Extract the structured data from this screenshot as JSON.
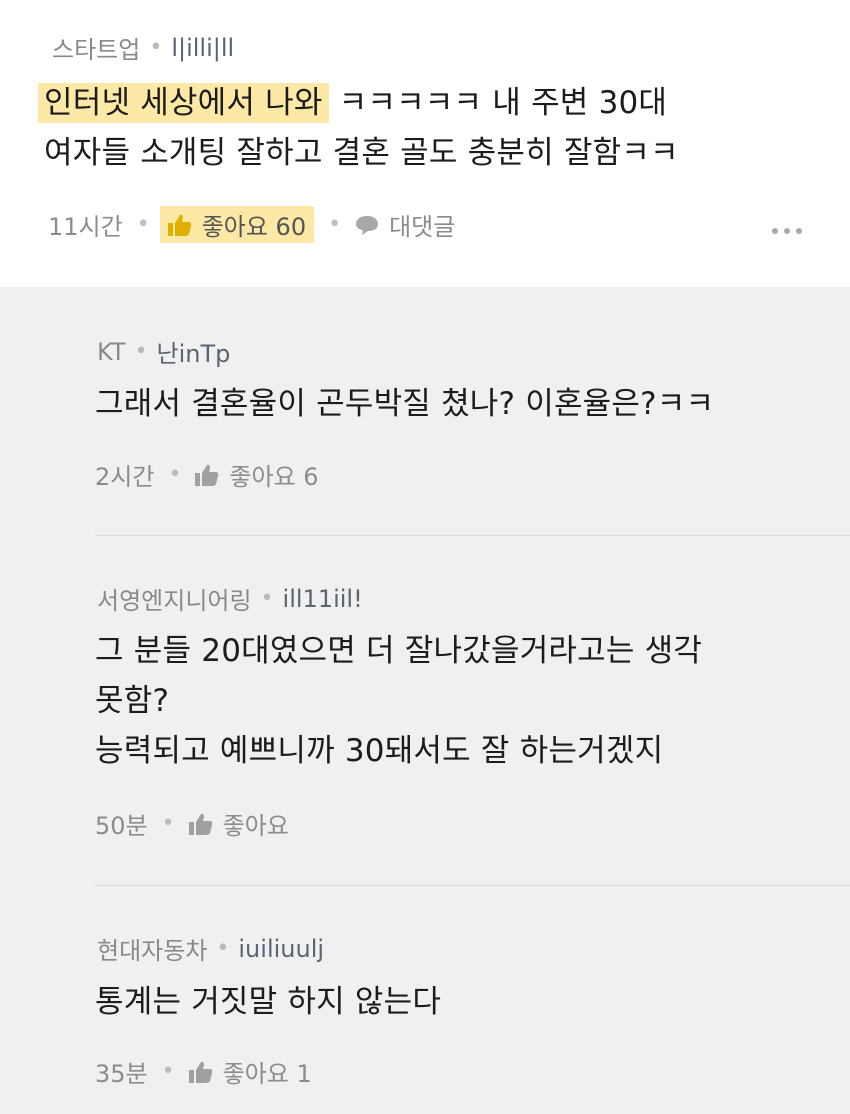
{
  "post": {
    "company": "스타트업",
    "nickname": "l|illi|ll",
    "highlight": "인터넷 세상에서 나와",
    "line1_rest": " ㅋㅋㅋㅋㅋ 내 주변 30대",
    "line2": "여자들 소개팅 잘하고 결혼 골도 충분히 잘함ㅋㅋ",
    "time": "11시간",
    "like_label": "좋아요 60",
    "reply_label": "대댓글"
  },
  "replies": [
    {
      "company": "KT",
      "nickname": "난inTp",
      "lines": [
        "그래서 결혼율이 곤두박질 쳤나? 이혼율은?ㅋㅋ"
      ],
      "time": "2시간",
      "like_label": "좋아요 6"
    },
    {
      "company": "서영엔지니어링",
      "nickname": "ill11iil!",
      "lines": [
        "그 분들 20대였으면 더 잘나갔을거라고는 생각",
        "못함?",
        "능력되고 예쁘니까 30돼서도 잘 하는거겠지"
      ],
      "time": "50분",
      "like_label": "좋아요"
    },
    {
      "company": "현대자동차",
      "nickname": "iuiliuulj",
      "lines": [
        "통계는 거짓말 하지 않는다"
      ],
      "time": "35분",
      "like_label": "좋아요 1"
    }
  ],
  "colors": {
    "highlight": "#fde9a6",
    "reply_bg": "#f0f0f0",
    "meta_text": "#8a8a8a"
  },
  "icons": [
    "thumbs-up-icon",
    "speech-bubble-icon",
    "more-dots-icon"
  ]
}
